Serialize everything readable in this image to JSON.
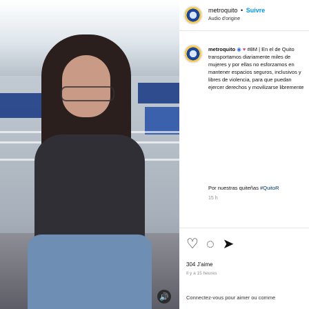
{
  "video": {
    "mute_icon": "speaker-icon"
  },
  "header": {
    "username": "metroquito",
    "dot": "•",
    "follow": "Suivre",
    "audio": "Audio d'origine"
  },
  "post": {
    "username": "metroquito",
    "caption_text": "#8M | En el de Quito transportamos diariamente miles de mujeres y por ellas no esforzamos en mantener espacios seguros, inclusivos y libres de violencia, para que puedan ejercer derechos y movilizarse libremente",
    "tag_prefix": "Por nuestras quiteñas",
    "tag": "#QuitoR",
    "time": "15 h"
  },
  "actions": {
    "likes": "304 J'aime",
    "ago": "Il y a 15 heures",
    "connect": "Connectez-vous pour aimer ou comme"
  },
  "colors": {
    "follow": "#0095f6",
    "metro_blue": "#1f3f86"
  }
}
